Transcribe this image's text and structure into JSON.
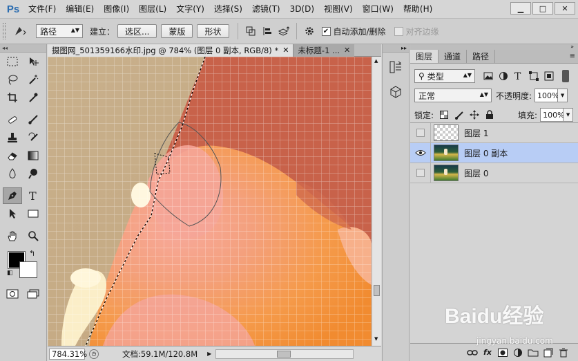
{
  "app": {
    "logo": "Ps"
  },
  "menu": [
    "文件(F)",
    "编辑(E)",
    "图像(I)",
    "图层(L)",
    "文字(Y)",
    "选择(S)",
    "滤镜(T)",
    "3D(D)",
    "视图(V)",
    "窗口(W)",
    "帮助(H)"
  ],
  "window_controls": {
    "minimize": "▁",
    "maximize": "□",
    "close": "✕"
  },
  "options": {
    "mode_value": "路径",
    "build_label": "建立：",
    "selection_button": "选区...",
    "mask_button": "蒙版",
    "shape_button": "形状",
    "auto_add_delete_label": "自动添加/删除",
    "auto_add_delete_checked": true,
    "align_edges_label": "对齐边缘",
    "align_edges_checked": false
  },
  "documents": {
    "active_tab": "摄图网_501359166水印.jpg @ 784% (图层 0 副本, RGB/8) *",
    "inactive_tab": "未标题-1 ..."
  },
  "status": {
    "zoom": "784.31%",
    "doc_size": "文档:59.1M/120.8M"
  },
  "layers_panel": {
    "tabs": [
      "图层",
      "通道",
      "路径"
    ],
    "filter_kind": "类型",
    "blend_mode": "正常",
    "opacity_label": "不透明度:",
    "opacity_value": "100%",
    "lock_label": "锁定:",
    "fill_label": "填充:",
    "fill_value": "100%",
    "layers": [
      {
        "name": "图层 1",
        "visible": false,
        "selected": false,
        "thumb": "transparent"
      },
      {
        "name": "图层 0 副本",
        "visible": true,
        "selected": true,
        "thumb": "photo"
      },
      {
        "name": "图层 0",
        "visible": false,
        "selected": false,
        "thumb": "photo"
      }
    ]
  },
  "watermark": {
    "brand": "Baidu经验",
    "url": "jingyan.baidu.com"
  },
  "colors": {
    "selection_blue": "#b8cdf5",
    "foreground": "#000000",
    "background": "#ffffff"
  }
}
